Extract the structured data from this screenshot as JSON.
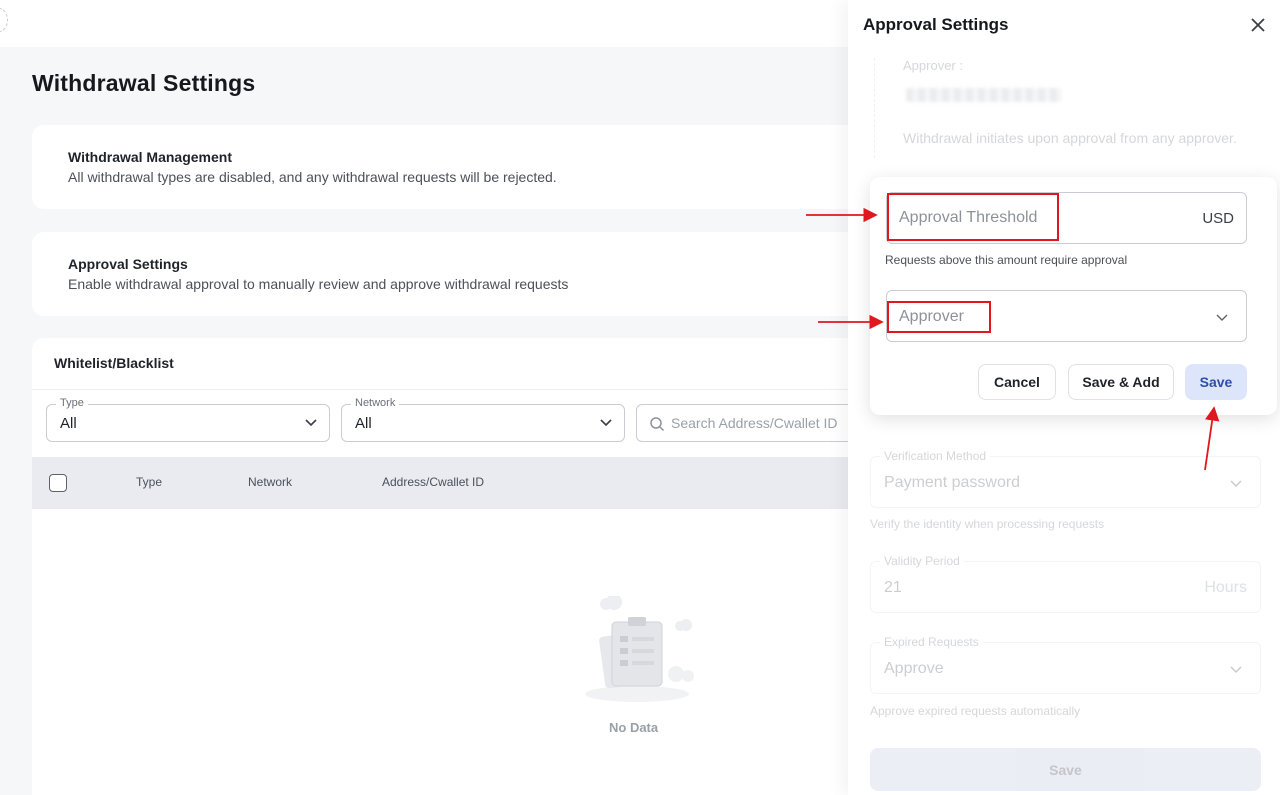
{
  "page": {
    "title": "Withdrawal Settings",
    "management": {
      "title": "Withdrawal Management",
      "description": "All withdrawal types are disabled, and any withdrawal requests will be rejected."
    },
    "approval": {
      "title": "Approval Settings",
      "description": "Enable withdrawal approval to manually review and approve withdrawal requests"
    },
    "whitelist": {
      "title": "Whitelist/Blacklist",
      "filters": {
        "type": {
          "label": "Type",
          "value": "All"
        },
        "network": {
          "label": "Network",
          "value": "All"
        },
        "search_placeholder": "Search Address/Cwallet ID"
      },
      "columns": [
        "Type",
        "Network",
        "Address/Cwallet ID"
      ],
      "empty_text": "No Data"
    }
  },
  "drawer": {
    "title": "Approval Settings",
    "approver_label": "Approver :",
    "approver_note": "Withdrawal initiates upon approval from any approver.",
    "popover": {
      "threshold_placeholder": "Approval Threshold",
      "threshold_unit": "USD",
      "threshold_help": "Requests above this amount require approval",
      "approver_placeholder": "Approver",
      "cancel_label": "Cancel",
      "save_add_label": "Save & Add",
      "save_label": "Save"
    },
    "verification": {
      "label": "Verification Method",
      "value": "Payment password",
      "help": "Verify the identity when processing requests"
    },
    "validity": {
      "label": "Validity Period",
      "value": "21",
      "unit": "Hours"
    },
    "expired": {
      "label": "Expired Requests",
      "value": "Approve",
      "help": "Approve expired requests automatically"
    },
    "save_label": "Save"
  },
  "colors": {
    "annotation": "#e0171c",
    "primary_soft": "#dde5fb",
    "primary_text": "#2e4ea8",
    "page_bg": "#f6f7f9"
  }
}
